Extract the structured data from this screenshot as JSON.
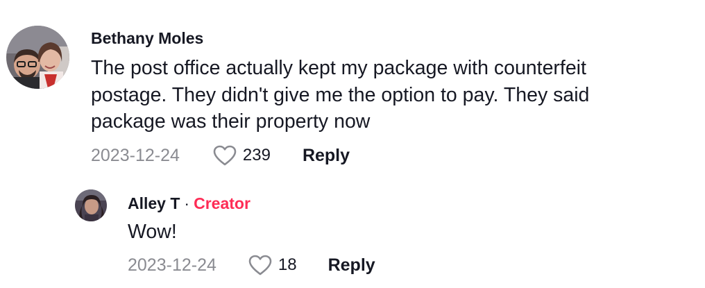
{
  "comments": [
    {
      "username": "Bethany Moles",
      "text": "The post office actually kept my package with counterfeit postage. They didn't give me the option to pay. They said package was their property now",
      "date": "2023-12-24",
      "likes": "239",
      "reply_label": "Reply",
      "avatar_icon": "user-avatar-photo"
    }
  ],
  "replies": [
    {
      "username": "Alley T",
      "separator": "·",
      "badge": "Creator",
      "text": "Wow!",
      "date": "2023-12-24",
      "likes": "18",
      "reply_label": "Reply",
      "avatar_icon": "user-avatar-photo"
    }
  ],
  "colors": {
    "text": "#161823",
    "muted": "#8a8b91",
    "creator_badge": "#fe2c55"
  },
  "icons": {
    "like": "heart-outline-icon"
  }
}
